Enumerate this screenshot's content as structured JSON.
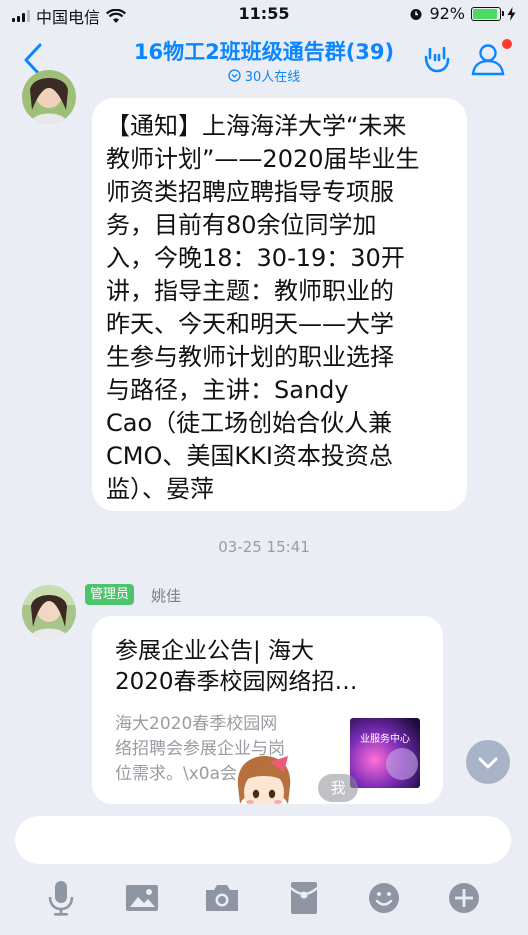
{
  "status_bar": {
    "carrier": "中国电信",
    "time": "11:55",
    "battery": "92%",
    "battery_level": 0.92
  },
  "header": {
    "title": "16物工2班班级通告群(39)",
    "online": "30人在线"
  },
  "messages": {
    "notice_text": "【通知】上海海洋大学“未来教师计划”——2020届毕业生师资类招聘应聘指导专项服务，目前有80余位同学加入，今晚18：30-19：30开讲，指导主题：教师职业的昨天、今天和明天——大学生参与教师计划的职业选择与路径，主讲：Sandy Cao（徒工场创始合伙人兼CMO、美国KKI资本投资总监）、晏萍",
    "notice_lines": [
      "【通知】上海海洋大学“未来",
      "教师计划”——2020届毕业生",
      "师资类招聘应聘指导专项服",
      "务，目前有80余位同学加",
      "入，今晚18：30-19：30开",
      "讲，指导主题：教师职业的",
      "昨天、今天和明天——大学",
      "生参与教师计划的职业选择",
      "与路径，主讲：Sandy",
      "Cao（徒工场创始合伙人兼",
      "CMO、美国KKI资本投资总",
      "监）、晏萍"
    ],
    "timestamp": "03-25 15:41",
    "admin_badge": "管理员",
    "sender_name": "姚佳",
    "card": {
      "title": "参展企业公告| 海大2020春季校园网络招…",
      "title_lines": [
        "参展企业公告| 海大",
        "2020春季校园网络招…"
      ],
      "desc_lines": [
        "海大2020春季校园网",
        "络招聘会参展企业与岗",
        "位需求。\\x0a会…"
      ],
      "thumb_text": "业服务中心"
    },
    "me_label": "我"
  },
  "input": {
    "placeholder": ""
  },
  "icons": {
    "back": "chevron-left-icon",
    "hand": "hand-gesture-icon",
    "group_members": "person-icon",
    "scroll_down": "chevron-down-icon",
    "voice": "microphone-icon",
    "image": "image-icon",
    "camera": "camera-icon",
    "red_packet": "red-packet-icon",
    "emoji": "emoji-icon",
    "more": "plus-icon"
  },
  "colors": {
    "accent": "#0a86ff",
    "background": "#ebedf5",
    "admin_badge": "#4cc46c",
    "badge_dot": "#ff3b30",
    "icon_gray": "#8e95a3"
  }
}
